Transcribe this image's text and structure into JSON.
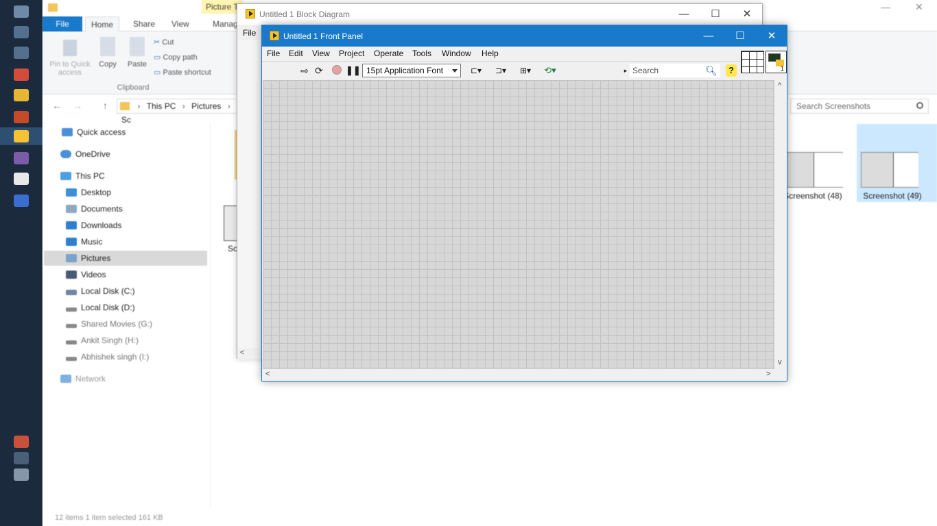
{
  "explorer": {
    "ribbon_tabs": [
      "File",
      "Home",
      "Share",
      "View"
    ],
    "context_tab_group": "Picture To",
    "context_tab": "Manag",
    "clipboard": {
      "pin_label": "Pin to Quick access",
      "copy_label": "Copy",
      "paste_label": "Paste",
      "cut_label": "Cut",
      "copy_path_label": "Copy path",
      "paste_shortcut_label": "Paste shortcut",
      "group_label": "Clipboard"
    },
    "breadcrumb": [
      "This PC",
      "Pictures",
      "Sc"
    ],
    "search_placeholder": "Search Screenshots",
    "nav": [
      {
        "label": "Quick access",
        "icon": "star-icon"
      },
      {
        "label": "OneDrive",
        "icon": "cloud-icon"
      },
      {
        "label": "This PC",
        "icon": "computer-icon"
      },
      {
        "label": "Desktop",
        "icon": "desktop-icon"
      },
      {
        "label": "Documents",
        "icon": "documents-icon"
      },
      {
        "label": "Downloads",
        "icon": "download-icon"
      },
      {
        "label": "Music",
        "icon": "music-icon"
      },
      {
        "label": "Pictures",
        "icon": "pictures-icon"
      },
      {
        "label": "Videos",
        "icon": "videos-icon"
      },
      {
        "label": "Local Disk (C:)",
        "icon": "drive-icon"
      },
      {
        "label": "Local Disk (D:)",
        "icon": "drive-icon"
      },
      {
        "label": "Shared Movies (G:)",
        "icon": "drive-icon"
      },
      {
        "label": "Ankit Singh (H:)",
        "icon": "drive-icon"
      },
      {
        "label": "Abhishek singh (I:)",
        "icon": "drive-icon"
      },
      {
        "label": "Network",
        "icon": "network-icon"
      }
    ],
    "files": [
      {
        "label": "Sc"
      },
      {
        "label": "Screenshot (48)"
      },
      {
        "label": "Screenshot (49)"
      }
    ],
    "status": "12 items    1 item selected  161 KB"
  },
  "block_diagram": {
    "title": "Untitled 1 Block Diagram",
    "menu_file": "File"
  },
  "front_panel": {
    "title": "Untitled 1 Front Panel",
    "menu": [
      "File",
      "Edit",
      "View",
      "Project",
      "Operate",
      "Tools",
      "Window",
      "Help"
    ],
    "font_select": "15pt Application Font",
    "search_placeholder": "Search",
    "vi_icon_number": "1"
  },
  "colors": {
    "accent": "#1979ca",
    "canvas": "#d7d7d7",
    "taskbar": "#1b2a3d"
  }
}
